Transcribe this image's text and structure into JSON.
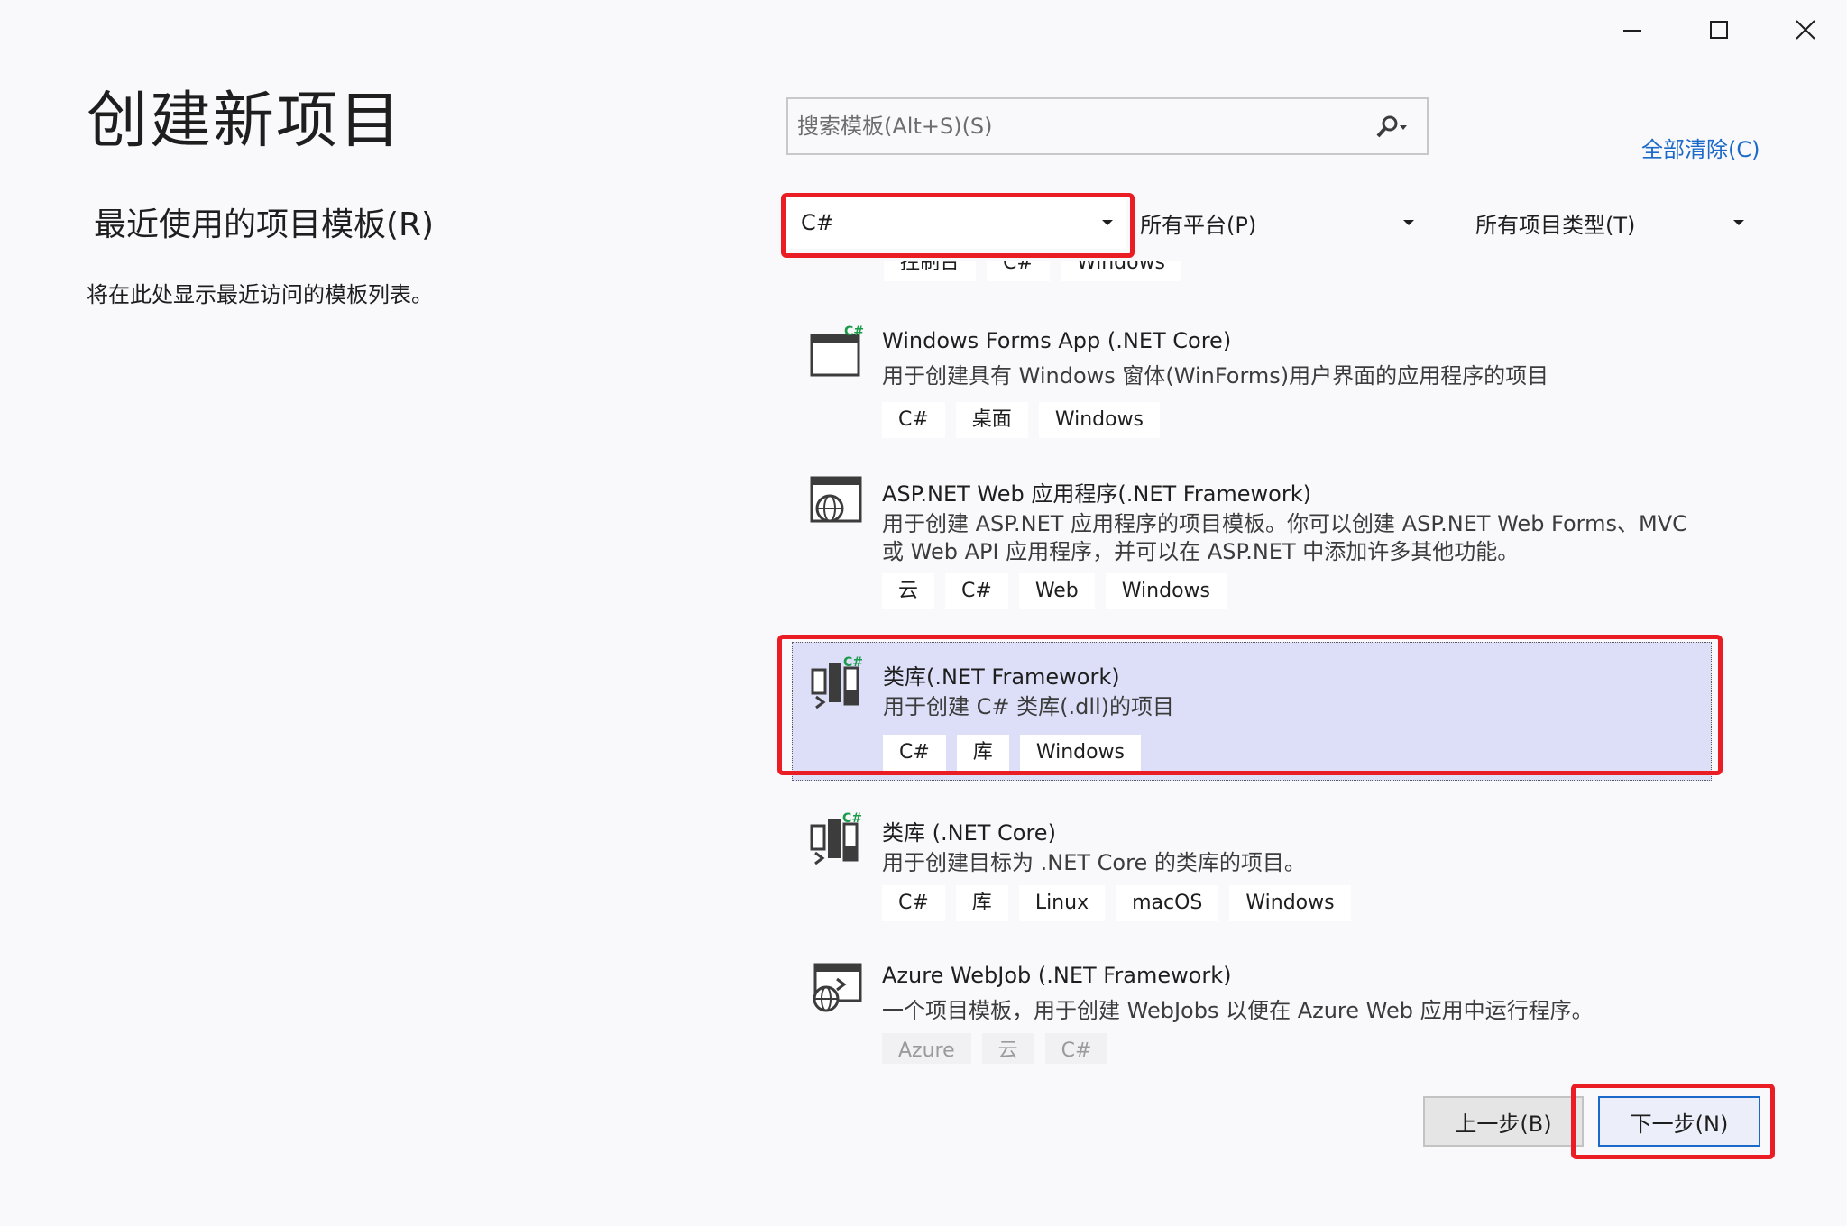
{
  "window": {
    "title": "创建新项目",
    "controls": [
      "minimize-icon",
      "maximize-icon",
      "close-icon"
    ]
  },
  "left": {
    "recent_heading": "最近使用的项目模板(R)",
    "recent_empty": "将在此处显示最近访问的模板列表。"
  },
  "search": {
    "placeholder": "搜索模板(Alt+S)(S)",
    "icon": "search-icon"
  },
  "clear_all": "全部清除(C)",
  "filters": {
    "language": "C#",
    "platform": "所有平台(P)",
    "project_type": "所有项目类型(T)"
  },
  "partial_tags": [
    "控制台",
    "C#",
    "Windows"
  ],
  "templates": [
    {
      "name": "Windows Forms App (.NET Core)",
      "description": "用于创建具有 Windows 窗体(WinForms)用户界面的应用程序的项目",
      "tags": [
        "C#",
        "桌面",
        "Windows"
      ],
      "icon": "winforms-icon"
    },
    {
      "name": "ASP.NET Web 应用程序(.NET Framework)",
      "description": "用于创建 ASP.NET 应用程序的项目模板。你可以创建 ASP.NET Web Forms、MVC 或 Web API 应用程序，并可以在 ASP.NET 中添加许多其他功能。",
      "tags": [
        "云",
        "C#",
        "Web",
        "Windows"
      ],
      "icon": "web-globe-icon"
    },
    {
      "name": "类库(.NET Framework)",
      "description": "用于创建 C# 类库(.dll)的项目",
      "tags": [
        "C#",
        "库",
        "Windows"
      ],
      "icon": "class-library-icon",
      "selected": true
    },
    {
      "name": "类库 (.NET Core)",
      "description": "用于创建目标为 .NET Core 的类库的项目。",
      "tags": [
        "C#",
        "库",
        "Linux",
        "macOS",
        "Windows"
      ],
      "icon": "class-library-icon"
    },
    {
      "name": "Azure WebJob (.NET Framework)",
      "description": "一个项目模板，用于创建 WebJobs 以便在 Azure Web 应用中运行程序。",
      "tags": [
        "Azure",
        "云",
        "C#"
      ],
      "icon": "azure-webjob-icon"
    }
  ],
  "buttons": {
    "back": "上一步(B)",
    "next": "下一步(N)"
  },
  "colors": {
    "accent": "#1b6ac9",
    "highlight_box": "#ea1c24",
    "selected_bg": "#dcdff7"
  }
}
